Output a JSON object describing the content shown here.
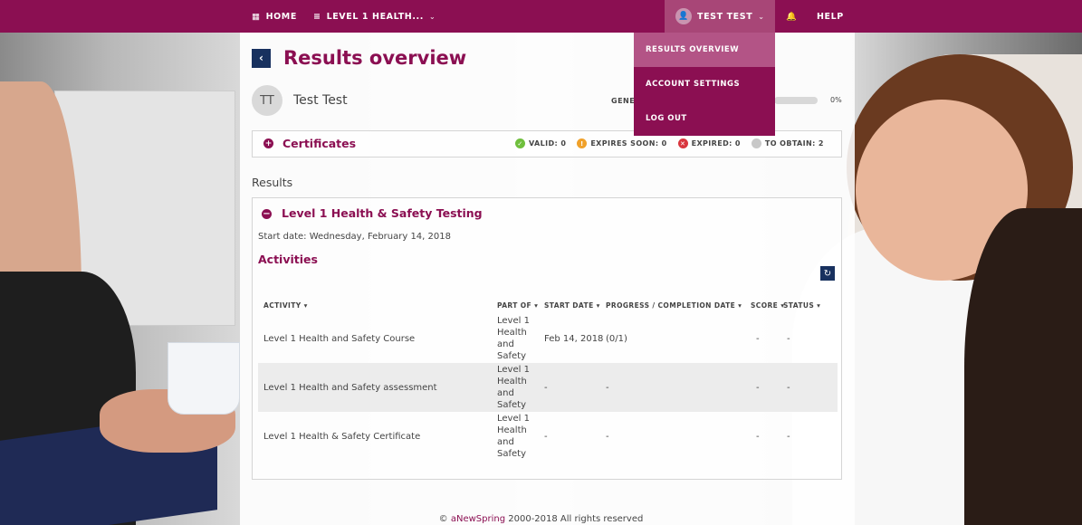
{
  "nav": {
    "home_label": "HOME",
    "course_label": "LEVEL 1 HEALTH...",
    "user_label": "TEST TEST",
    "help_label": "HELP"
  },
  "dropdown": {
    "items": [
      {
        "label": "RESULTS OVERVIEW"
      },
      {
        "label": "ACCOUNT SETTINGS"
      },
      {
        "label": "LOG OUT"
      }
    ]
  },
  "page": {
    "title": "Results overview"
  },
  "user": {
    "initials": "TT",
    "name": "Test Test",
    "general_label": "GENE",
    "progress_pct": "0%"
  },
  "certificates": {
    "title": "Certificates",
    "valid": "VALID: 0",
    "expires_soon": "EXPIRES SOON: 0",
    "expired": "EXPIRED: 0",
    "to_obtain": "TO OBTAIN: 2"
  },
  "results": {
    "label": "Results",
    "course_title": "Level 1 Health & Safety Testing",
    "start_date": "Start date: Wednesday, February 14, 2018",
    "activities_label": "Activities",
    "columns": {
      "activity": "ACTIVITY ▾",
      "part_of": "PART OF ▾",
      "start_date": "START DATE ▾",
      "progress": "PROGRESS / COMPLETION DATE ▾",
      "score": "SCORE ▾",
      "status": "STATUS ▾"
    },
    "rows": [
      {
        "activity": "Level 1 Health and Safety Course",
        "part_of": "Level 1 Health and Safety",
        "start_date": "Feb 14, 2018",
        "progress": "(0/1)",
        "score": "-",
        "status": "-"
      },
      {
        "activity": "Level 1 Health and Safety assessment",
        "part_of": "Level 1 Health and Safety",
        "start_date": "-",
        "progress": "-",
        "score": "-",
        "status": "-"
      },
      {
        "activity": "Level 1 Health & Safety Certificate",
        "part_of": "Level 1 Health and Safety",
        "start_date": "-",
        "progress": "-",
        "score": "-",
        "status": "-"
      }
    ]
  },
  "footer": {
    "prefix": "©",
    "brand": "aNewSpring",
    "suffix": "2000-2018 All rights reserved"
  },
  "colors": {
    "brand": "#8b0f52",
    "navy": "#18315f"
  }
}
